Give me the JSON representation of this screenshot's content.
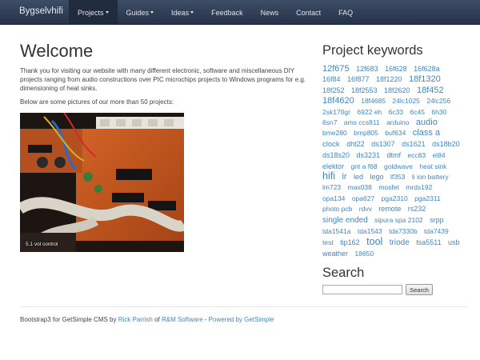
{
  "navbar": {
    "brand": "Bygselvhifi",
    "items": [
      {
        "label": "Projects",
        "dropdown": true,
        "active": true
      },
      {
        "label": "Guides",
        "dropdown": true,
        "active": false
      },
      {
        "label": "Ideas",
        "dropdown": true,
        "active": false
      },
      {
        "label": "Feedback",
        "dropdown": false,
        "active": false
      },
      {
        "label": "News",
        "dropdown": false,
        "active": false
      },
      {
        "label": "Contact",
        "dropdown": false,
        "active": false
      },
      {
        "label": "FAQ",
        "dropdown": false,
        "active": false
      }
    ]
  },
  "main": {
    "title": "Welcome",
    "intro": "Thank you for visiting our website with many different electronic, software and miscellaneous DIY projects ranging from audio constructions over PIC microchips projects to Windows programs for e.g. dimensioning of heat sinks.",
    "below": "Below are some pictures of our more than 50 projects:",
    "photo_caption": "5.1 vol control"
  },
  "sidebar": {
    "keywords_title": "Project keywords",
    "keywords": [
      {
        "t": "12f675",
        "s": 11
      },
      {
        "t": "12f683",
        "s": 9
      },
      {
        "t": "16f628",
        "s": 9
      },
      {
        "t": "16f628a",
        "s": 9
      },
      {
        "t": "16f84",
        "s": 9
      },
      {
        "t": "16f877",
        "s": 9
      },
      {
        "t": "18f1220",
        "s": 9
      },
      {
        "t": "18f1320",
        "s": 11
      },
      {
        "t": "18f252",
        "s": 9
      },
      {
        "t": "18f2553",
        "s": 9
      },
      {
        "t": "18f2620",
        "s": 9
      },
      {
        "t": "18f452",
        "s": 11
      },
      {
        "t": "18f4620",
        "s": 11
      },
      {
        "t": "18f4685",
        "s": 8.5
      },
      {
        "t": "24lc1025",
        "s": 8.5
      },
      {
        "t": "24lc256",
        "s": 8.5
      },
      {
        "t": "2sk170gr",
        "s": 8.5
      },
      {
        "t": "6922 eh",
        "s": 8.5
      },
      {
        "t": "6c33",
        "s": 8.5
      },
      {
        "t": "6c45",
        "s": 8.5
      },
      {
        "t": "6h30",
        "s": 8.5
      },
      {
        "t": "6sn7",
        "s": 8.5
      },
      {
        "t": "ams ccs811",
        "s": 8.5
      },
      {
        "t": "arduino",
        "s": 8.5
      },
      {
        "t": "audio",
        "s": 11
      },
      {
        "t": "bme280",
        "s": 8.5
      },
      {
        "t": "bmp805",
        "s": 8.5
      },
      {
        "t": "buf634",
        "s": 8.5
      },
      {
        "t": "class a",
        "s": 11
      },
      {
        "t": "clock",
        "s": 9.5
      },
      {
        "t": "dht22",
        "s": 9
      },
      {
        "t": "ds1307",
        "s": 9
      },
      {
        "t": "ds1621",
        "s": 9
      },
      {
        "t": "ds18b20",
        "s": 9
      },
      {
        "t": "ds18s20",
        "s": 9
      },
      {
        "t": "ds3231",
        "s": 9
      },
      {
        "t": "dtmf",
        "s": 9
      },
      {
        "t": "ecc83",
        "s": 8.5
      },
      {
        "t": "el84",
        "s": 8.5
      },
      {
        "t": "elektor",
        "s": 9
      },
      {
        "t": "gnt a f68",
        "s": 8.5
      },
      {
        "t": "goldwave",
        "s": 8.5
      },
      {
        "t": "heat sink",
        "s": 8.5
      },
      {
        "t": "hifi",
        "s": 12.5
      },
      {
        "t": "ir",
        "s": 11
      },
      {
        "t": "led",
        "s": 9
      },
      {
        "t": "lego",
        "s": 9
      },
      {
        "t": "lf353",
        "s": 8.5
      },
      {
        "t": "li ion battery",
        "s": 8.5
      },
      {
        "t": "lm723",
        "s": 8.5
      },
      {
        "t": "max038",
        "s": 8.5
      },
      {
        "t": "mosfet",
        "s": 8.5
      },
      {
        "t": "mrds192",
        "s": 8.5
      },
      {
        "t": "opa134",
        "s": 8.5
      },
      {
        "t": "opa627",
        "s": 8.5
      },
      {
        "t": "pga2310",
        "s": 8.5
      },
      {
        "t": "pga2311",
        "s": 8.5
      },
      {
        "t": "photo pcb",
        "s": 8.5
      },
      {
        "t": "rdvv",
        "s": 8.5
      },
      {
        "t": "remote",
        "s": 9
      },
      {
        "t": "rs232",
        "s": 9
      },
      {
        "t": "single ended",
        "s": 10
      },
      {
        "t": "sipura spa 2102",
        "s": 8.5
      },
      {
        "t": "srpp",
        "s": 9
      },
      {
        "t": "tda1541a",
        "s": 8.5
      },
      {
        "t": "tda1543",
        "s": 8.5
      },
      {
        "t": "tda7330b",
        "s": 8.5
      },
      {
        "t": "tda7439",
        "s": 8.5
      },
      {
        "t": "test",
        "s": 8.5
      },
      {
        "t": "tip162",
        "s": 9
      },
      {
        "t": "tool",
        "s": 12.5
      },
      {
        "t": "triode",
        "s": 10
      },
      {
        "t": "tsa5511",
        "s": 9
      },
      {
        "t": "usb",
        "s": 9
      },
      {
        "t": "weather",
        "s": 9
      },
      {
        "t": "18650",
        "s": 8.5
      }
    ],
    "search_title": "Search",
    "search_placeholder": "",
    "search_button": "Search"
  },
  "footer": {
    "prefix": "Bootstrap3 for GetSimple CMS by ",
    "author": "Rick Parrish",
    "of": " of ",
    "company": "R&M Software",
    "sep": " - ",
    "powered": "Powered by GetSimple"
  },
  "colors": {
    "navbar": "#2f3d55",
    "link": "#3f87c2",
    "text": "#333333"
  }
}
